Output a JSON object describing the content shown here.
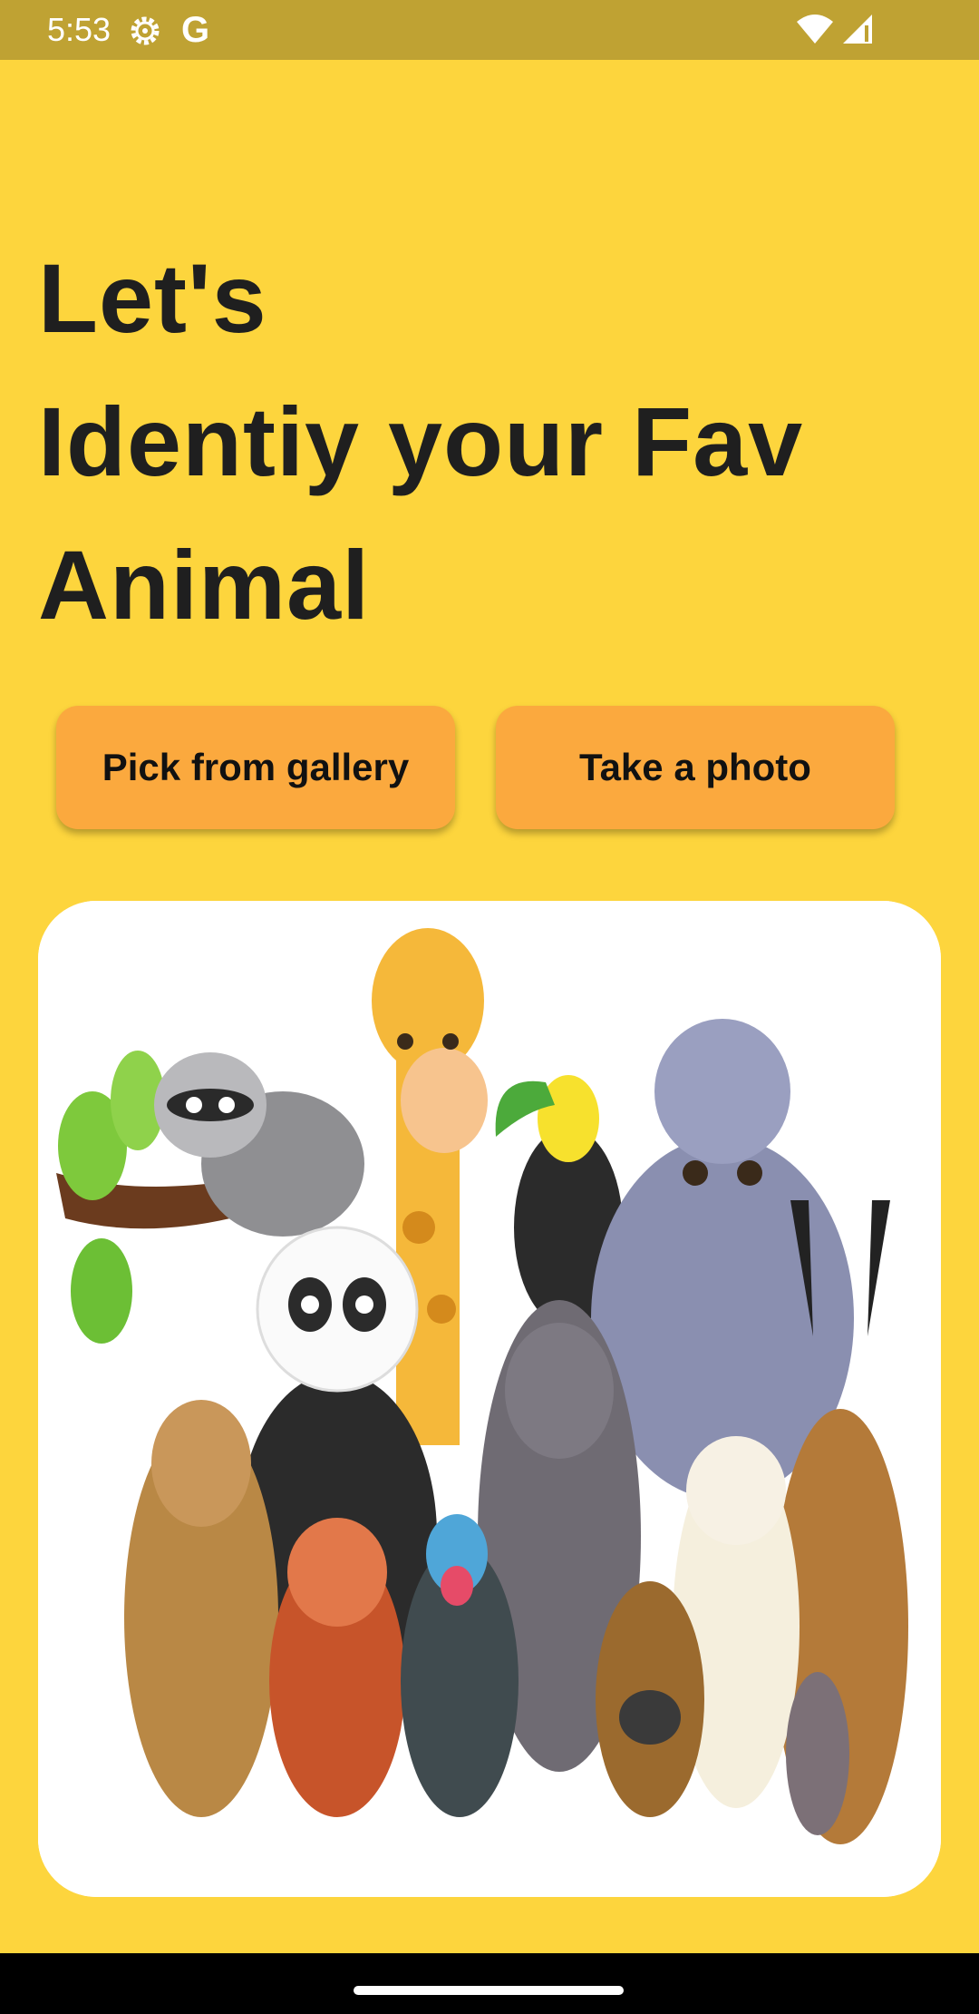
{
  "status_bar": {
    "time": "5:53",
    "google_glyph": "G",
    "icons": [
      "settings-gear-icon",
      "google-icon",
      "wifi-icon",
      "cell-signal-icon"
    ],
    "background_color": "#BFA233"
  },
  "headline": {
    "line1": "Let's",
    "line2": "Identiy your Fav",
    "line3": "Animal"
  },
  "buttons": {
    "gallery_label": "Pick from gallery",
    "photo_label": "Take a photo",
    "color": "#FBA93E"
  },
  "image": {
    "description_icon": "animal-group-illustration"
  },
  "theme": {
    "background": "#FDD53D"
  }
}
